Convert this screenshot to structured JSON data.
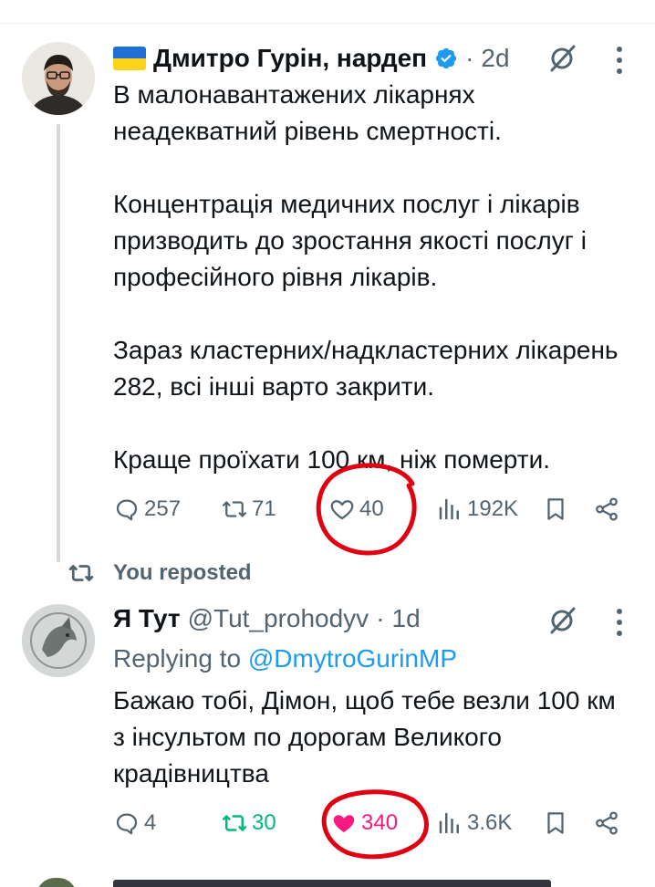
{
  "tweets": [
    {
      "name": "Дмитро Гурін, нардеп",
      "flag": "ukraine-flag",
      "verified": true,
      "time": "2d",
      "paragraphs": [
        "В малонавантажених лікарнях неадекватний рівень смертності.",
        "Концентрація медичних послуг і лікарів призводить до зростання якості послуг і професійного рівня лікарів.",
        "Зараз кластерних/надкластерних лікарень 282, всі інші варто закрити.",
        "Краще проїхати 100 км, ніж померти."
      ],
      "actions": {
        "replies": "257",
        "reposts": "71",
        "likes": "40",
        "views": "192K"
      }
    },
    {
      "name": "Я Тут",
      "handle": "@Tut_prohodyv",
      "time": "1d",
      "replying_prefix": "Replying to",
      "replying_to": "@DmytroGurinMP",
      "text": "Бажаю тобі, Дімон, щоб тебе везли 100 км з інсультом по дорогам Великого крадівництва",
      "actions": {
        "replies": "4",
        "reposts": "30",
        "likes": "340",
        "views": "3.6K"
      },
      "reposted_by_you": true,
      "liked_by_you": true
    }
  ],
  "repost_context": "You reposted",
  "separator": "·",
  "colors": {
    "text": "#0f1419",
    "secondary": "#536471",
    "link": "#1d9bf0",
    "verified": "#1d9bf0",
    "repost_active": "#00ba7c",
    "like_active": "#f91880",
    "annotation_circle": "#e00012"
  }
}
